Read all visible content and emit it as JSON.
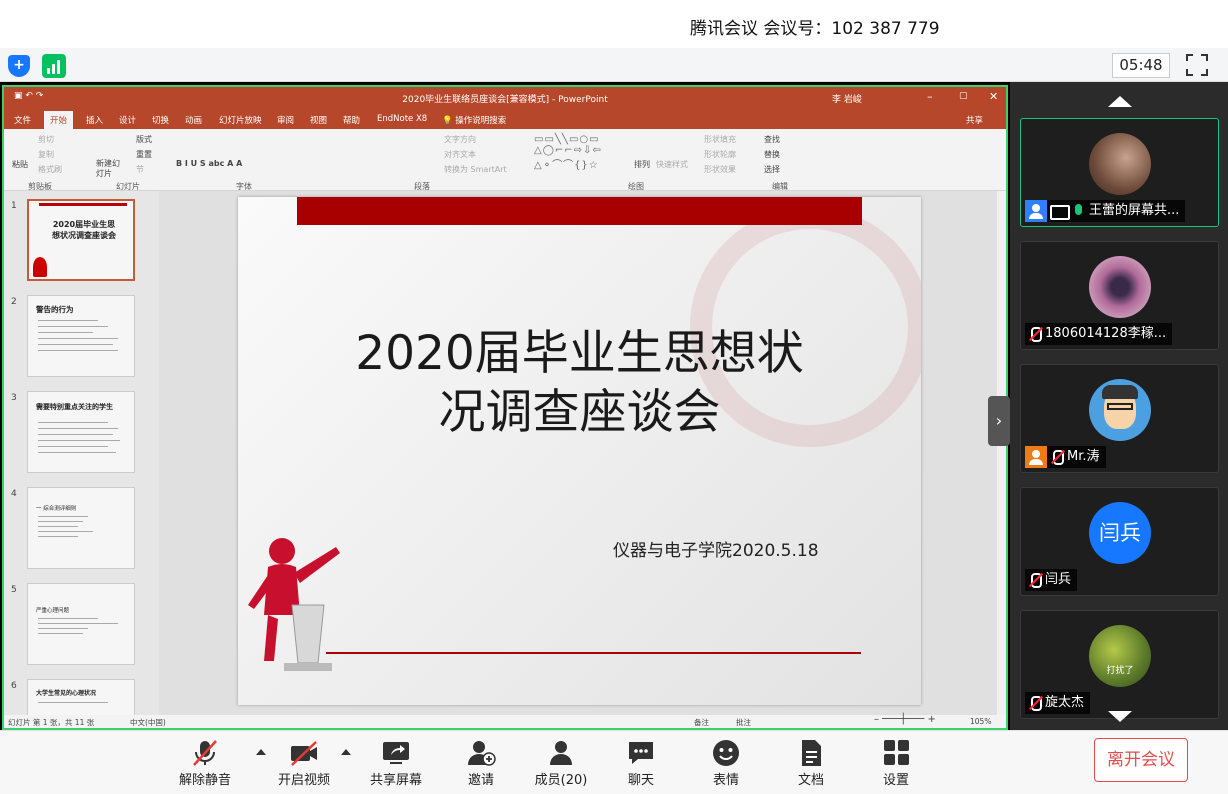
{
  "header": {
    "title": "腾讯会议 会议号：102 387 779"
  },
  "meeting_bar": {
    "timer": "05:48"
  },
  "powerpoint": {
    "window_title": "2020毕业生联络员座谈会[兼容模式] - PowerPoint",
    "user": "李 岩峻",
    "ribbon_tabs": [
      "文件",
      "开始",
      "插入",
      "设计",
      "切换",
      "动画",
      "幻灯片放映",
      "审阅",
      "视图",
      "帮助",
      "EndNote X8"
    ],
    "active_tab": "开始",
    "tell_me": "操作说明搜索",
    "share": "共享",
    "ribbon": {
      "paste": "粘贴",
      "cut": "剪切",
      "copy": "复制",
      "format_painter": "格式刷",
      "clipboard": "剪贴板",
      "new_slide": "新建幻灯片",
      "layout": "版式",
      "reset": "重置",
      "section": "节",
      "slides_group": "幻灯片",
      "font_group": "字体",
      "text_direction": "文字方向",
      "align_text": "对齐文本",
      "smartart": "转换为 SmartArt",
      "paragraph_group": "段落",
      "arrange": "排列",
      "quick_styles": "快速样式",
      "shape_fill": "形状填充",
      "shape_outline": "形状轮廓",
      "shape_effects": "形状效果",
      "drawing_group": "绘图",
      "find": "查找",
      "replace": "替换",
      "select": "选择",
      "editing_group": "编辑"
    },
    "thumbnails": [
      {
        "num": "1",
        "title": "2020届毕业生思想状况调查座谈会"
      },
      {
        "num": "2",
        "title": "警告的行为"
      },
      {
        "num": "3",
        "title": "需要特别重点关注的学生"
      },
      {
        "num": "4",
        "title": "一 综合测评细则"
      },
      {
        "num": "5",
        "title": "严重心理问题"
      },
      {
        "num": "6",
        "title": "大学生常见的心理状况"
      }
    ],
    "slide": {
      "title_line1": "2020届毕业生思想状",
      "title_line2": "况调查座谈会",
      "subtitle": "仪器与电子学院2020.5.18"
    },
    "status": {
      "slide_count": "幻灯片 第 1 张，共 11 张",
      "language": "中文(中国)",
      "notes": "备注",
      "comments": "批注",
      "zoom": "105%"
    }
  },
  "participants": [
    {
      "name": "王蕾的屏幕共...",
      "active": true,
      "mic": "on"
    },
    {
      "name": "1806014128李稼...",
      "active": false,
      "mic": "off"
    },
    {
      "name": "Mr.涛",
      "active": false,
      "mic": "off"
    },
    {
      "name": "闫兵",
      "avatar_text": "闫兵",
      "active": false,
      "mic": "off"
    },
    {
      "name": "旋太杰",
      "avatar_text": "打扰了",
      "active": false,
      "mic": "off"
    }
  ],
  "toolbar": {
    "unmute": "解除静音",
    "start_video": "开启视频",
    "share_screen": "共享屏幕",
    "invite": "邀请",
    "members": "成员(20)",
    "chat": "聊天",
    "reactions": "表情",
    "docs": "文档",
    "settings": "设置",
    "leave": "离开会议"
  },
  "colors": {
    "accent": "#1677ff",
    "active_border": "#19c47d",
    "leave": "#e34d4d",
    "ppt": "#b7472a"
  }
}
